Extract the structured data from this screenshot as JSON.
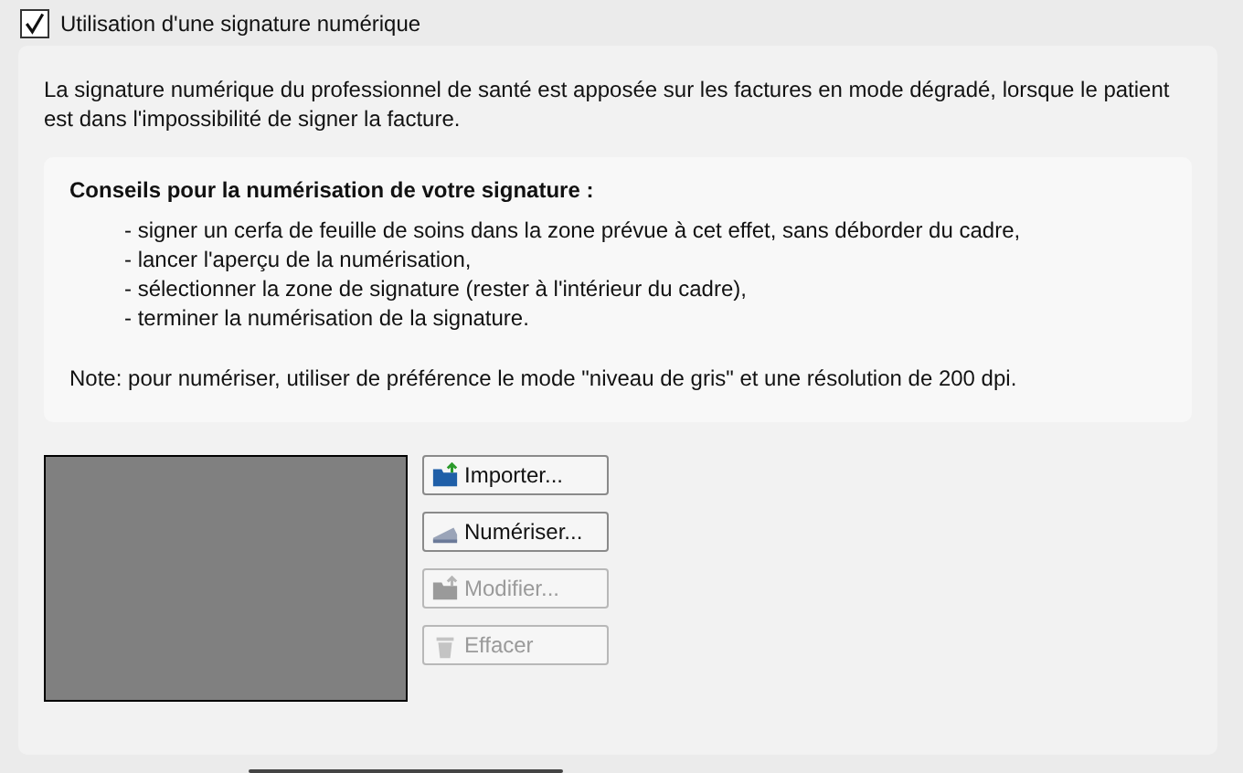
{
  "signature_option": {
    "label": "Utilisation d'une signature numérique",
    "checked": true
  },
  "description": "La signature numérique du professionnel de santé est apposée sur les factures en mode dégradé, lorsque le patient est dans l'impossibilité de signer la facture.",
  "advice": {
    "title": "Conseils pour la numérisation de votre signature :",
    "steps": [
      "- signer un cerfa de feuille de soins dans la zone prévue à cet effet, sans déborder du cadre,",
      "- lancer l'aperçu de la numérisation,",
      "- sélectionner la zone de signature (rester à l'intérieur du cadre),",
      "- terminer la numérisation de la signature."
    ],
    "note": "Note: pour numériser, utiliser de préférence le mode \"niveau de gris\" et une résolution de 200 dpi."
  },
  "buttons": [
    {
      "kind": "import",
      "label": "Importer...",
      "disabled": false
    },
    {
      "kind": "scan",
      "label": "Numériser...",
      "disabled": false
    },
    {
      "kind": "edit",
      "label": "Modifier...",
      "disabled": true
    },
    {
      "kind": "clear",
      "label": "Effacer",
      "disabled": true
    }
  ]
}
